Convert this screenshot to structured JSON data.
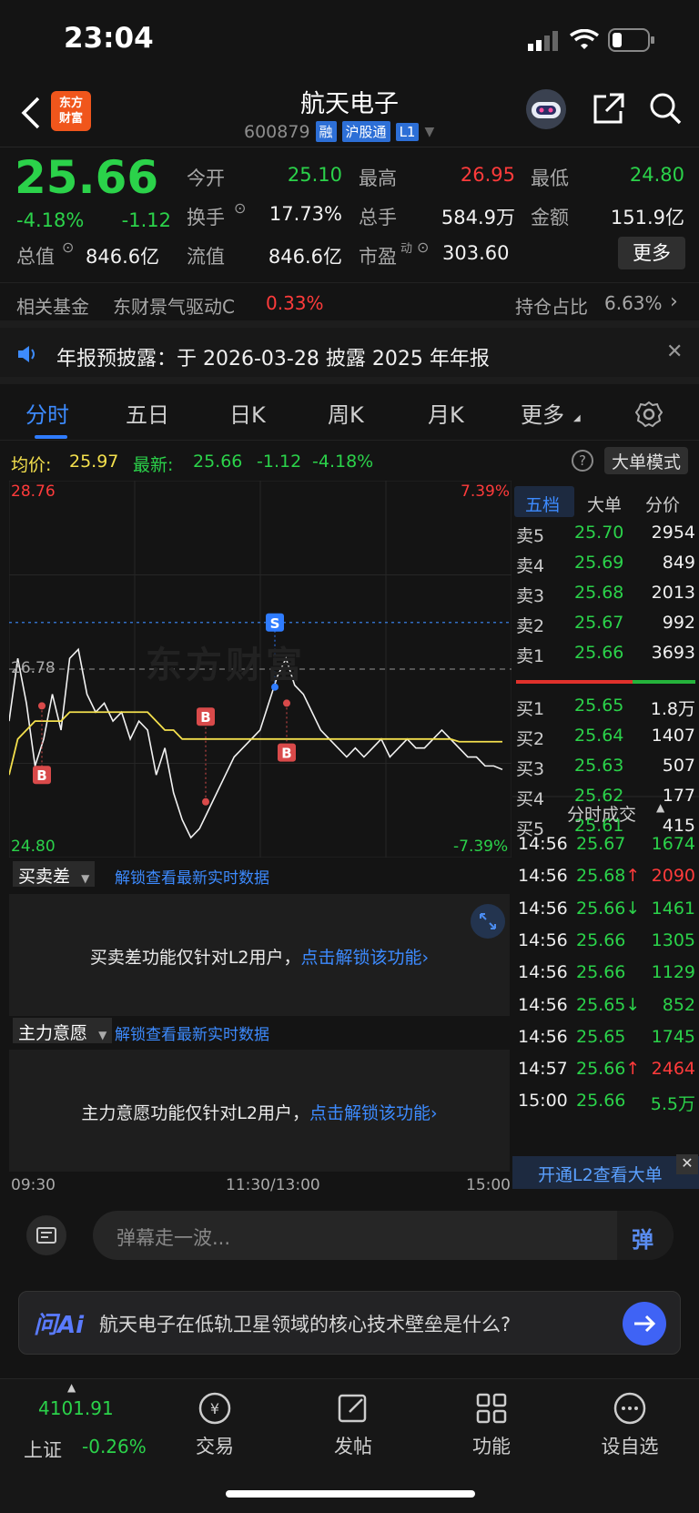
{
  "status_bar": {
    "time": "23:04"
  },
  "header": {
    "title": "航天电子",
    "code": "600879",
    "tags": [
      "融",
      "沪股通",
      "L1"
    ],
    "logo_text_1": "东方",
    "logo_text_2": "财富"
  },
  "quote": {
    "price": "25.66",
    "change_pct": "-4.18%",
    "change": "-1.12",
    "open_label": "今开",
    "open": "25.10",
    "high_label": "最高",
    "high": "26.95",
    "low_label": "最低",
    "low": "24.80",
    "turnover_label": "换手",
    "turnover": "17.73%",
    "volume_label": "总手",
    "volume": "584.9万",
    "amount_label": "金额",
    "amount": "151.9亿",
    "mktcap_label": "总值",
    "mktcap": "846.6亿",
    "float_label": "流值",
    "float_cap": "846.6亿",
    "pe_label": "市盈",
    "pe_sup": "动",
    "pe": "303.60",
    "more_button": "更多"
  },
  "fund_row": {
    "label": "相关基金",
    "fund_name": "东财景气驱动C",
    "fund_change": "0.33%",
    "holding_label": "持仓占比",
    "holding": "6.63%"
  },
  "notice": {
    "text": "年报预披露：于 2026-03-28 披露 2025 年年报"
  },
  "tabs": [
    "分时",
    "五日",
    "日K",
    "周K",
    "月K",
    "更多"
  ],
  "legend": {
    "avg_label": "均价:",
    "avg": "25.97",
    "latest_label": "最新:",
    "latest": "25.66",
    "latest_change": "-1.12",
    "latest_pct": "-4.18%",
    "mode_button": "大单模式"
  },
  "chart_labels": {
    "top_price": "28.76",
    "top_pct": "7.39%",
    "bottom_price": "24.80",
    "bottom_pct": "-7.39%",
    "prev_close": "26.78",
    "time_start": "09:30",
    "time_mid": "11:30/13:00",
    "time_end": "15:00",
    "watermark": "东方财富"
  },
  "chart_data": {
    "type": "line",
    "ylim": [
      24.8,
      28.76
    ],
    "prev_close": 26.78,
    "series": [
      {
        "name": "最新",
        "values": [
          26.2,
          26.9,
          26.4,
          25.7,
          26.0,
          26.5,
          26.1,
          26.9,
          27.0,
          26.5,
          26.3,
          26.4,
          26.2,
          26.3,
          26.0,
          26.2,
          26.1,
          25.6,
          25.9,
          25.4,
          25.1,
          24.9,
          25.0,
          25.2,
          25.4,
          25.6,
          25.8,
          25.9,
          26.0,
          26.1,
          26.4,
          26.7,
          26.9,
          26.6,
          26.5,
          26.3,
          26.1,
          26.0,
          25.9,
          25.8,
          25.9,
          25.8,
          25.9,
          26.0,
          25.8,
          25.9,
          26.0,
          25.9,
          25.9,
          26.0,
          26.1,
          26.0,
          25.9,
          25.8,
          25.8,
          25.7,
          25.7,
          25.66
        ]
      },
      {
        "name": "均价",
        "values": [
          25.6,
          26.0,
          26.1,
          26.2,
          26.2,
          26.2,
          26.2,
          26.3,
          26.3,
          26.3,
          26.3,
          26.3,
          26.3,
          26.3,
          26.3,
          26.3,
          26.3,
          26.2,
          26.1,
          26.1,
          26.0,
          26.0,
          26.0,
          26.0,
          26.0,
          26.0,
          26.0,
          26.0,
          26.0,
          26.0,
          26.0,
          26.0,
          26.0,
          26.0,
          26.0,
          26.0,
          26.0,
          26.0,
          26.0,
          26.0,
          26.0,
          26.0,
          26.0,
          26.0,
          26.0,
          26.0,
          26.0,
          26.0,
          26.0,
          26.0,
          26.0,
          26.0,
          25.97,
          25.97,
          25.97,
          25.97,
          25.97,
          25.97
        ]
      }
    ],
    "markers": [
      "B",
      "B",
      "B",
      "S"
    ]
  },
  "order_book": {
    "tabs": [
      "五档",
      "大单",
      "分价"
    ],
    "asks": [
      {
        "label": "卖5",
        "price": "25.70",
        "vol": "2954"
      },
      {
        "label": "卖4",
        "price": "25.69",
        "vol": "849"
      },
      {
        "label": "卖3",
        "price": "25.68",
        "vol": "2013"
      },
      {
        "label": "卖2",
        "price": "25.67",
        "vol": "992"
      },
      {
        "label": "卖1",
        "price": "25.66",
        "vol": "3693"
      }
    ],
    "bids": [
      {
        "label": "买1",
        "price": "25.65",
        "vol": "1.8万"
      },
      {
        "label": "买2",
        "price": "25.64",
        "vol": "1407"
      },
      {
        "label": "买3",
        "price": "25.63",
        "vol": "507"
      },
      {
        "label": "买4",
        "price": "25.62",
        "vol": "177"
      },
      {
        "label": "买5",
        "price": "25.61",
        "vol": "415"
      }
    ],
    "ticks_title": "分时成交",
    "ticks": [
      {
        "time": "14:56",
        "price": "25.67",
        "vol": "1674",
        "dir": ""
      },
      {
        "time": "14:56",
        "price": "25.68↑",
        "vol": "2090",
        "dir": "up"
      },
      {
        "time": "14:56",
        "price": "25.66↓",
        "vol": "1461",
        "dir": ""
      },
      {
        "time": "14:56",
        "price": "25.66",
        "vol": "1305",
        "dir": ""
      },
      {
        "time": "14:56",
        "price": "25.66",
        "vol": "1129",
        "dir": ""
      },
      {
        "time": "14:56",
        "price": "25.65↓",
        "vol": "852",
        "dir": ""
      },
      {
        "time": "14:56",
        "price": "25.65",
        "vol": "1745",
        "dir": ""
      },
      {
        "time": "14:57",
        "price": "25.66↑",
        "vol": "2464",
        "dir": "up"
      },
      {
        "time": "15:00",
        "price": "25.66",
        "vol": "5.5万",
        "dir": ""
      }
    ],
    "l2_banner": "开通L2查看大单"
  },
  "panels": {
    "p1_dropdown": "买卖差",
    "p1_unlock": "解锁查看最新实时数据",
    "p1_text": "买卖差功能仅针对L2用户，",
    "p1_link": "点击解锁该功能",
    "p2_dropdown": "主力意愿",
    "p2_unlock": "解锁查看最新实时数据",
    "p2_text": "主力意愿功能仅针对L2用户，",
    "p2_link": "点击解锁该功能"
  },
  "danmu": {
    "placeholder": "弹幕走一波...",
    "send": "弹"
  },
  "ai": {
    "brand": "问Ai",
    "question": "航天电子在低轨卫星领域的核心技术壁垒是什么?"
  },
  "bottom_nav": {
    "index_value": "4101.91",
    "index_name": "上证",
    "index_pct": "-0.26%",
    "items": [
      "交易",
      "发帖",
      "功能",
      "设自选"
    ]
  }
}
